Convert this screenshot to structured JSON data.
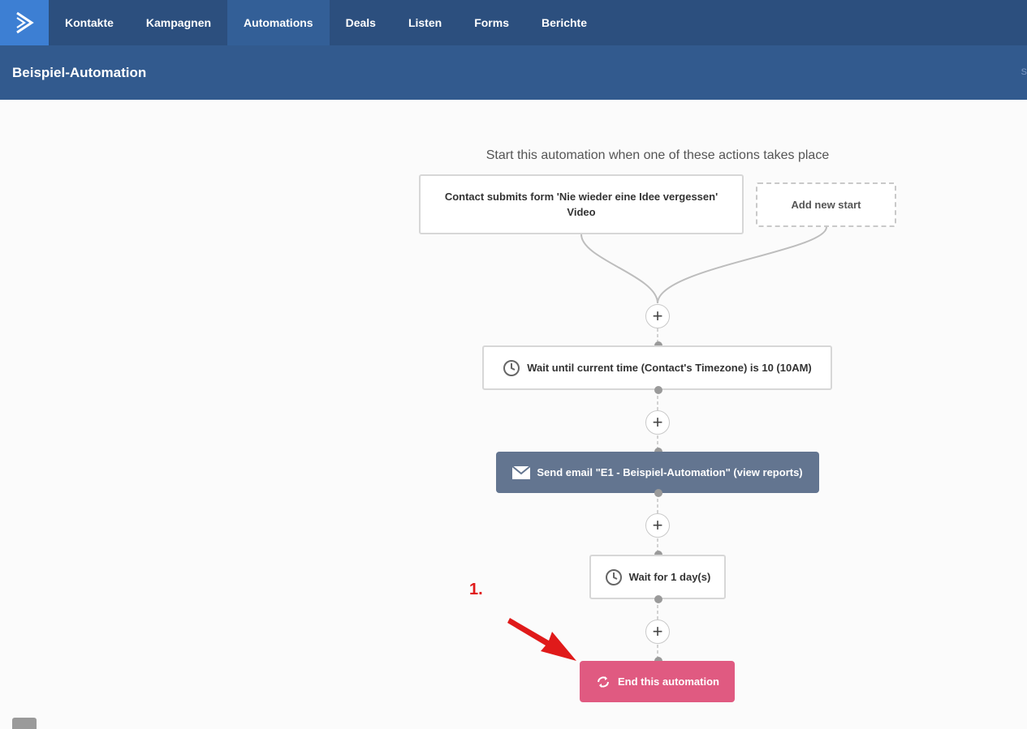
{
  "nav": {
    "items": [
      {
        "label": "Kontakte"
      },
      {
        "label": "Kampagnen"
      },
      {
        "label": "Automations"
      },
      {
        "label": "Deals"
      },
      {
        "label": "Listen"
      },
      {
        "label": "Forms"
      },
      {
        "label": "Berichte"
      }
    ],
    "active_item": "Automations"
  },
  "header": {
    "title": "Beispiel-Automation",
    "right_edge_text": "S"
  },
  "workflow": {
    "heading": "Start this automation when one of these actions takes place",
    "trigger": {
      "label": "Contact submits form 'Nie wieder eine Idee vergessen' Video"
    },
    "add_start_label": "Add new start",
    "steps": [
      {
        "icon": "clock-icon",
        "label": "Wait until current time (Contact's Timezone) is 10 (10AM)"
      },
      {
        "icon": "envelope-icon",
        "label": "Send email \"E1 - Beispiel-Automation\" (view reports)"
      },
      {
        "icon": "clock-icon",
        "label": "Wait for 1 day(s)"
      },
      {
        "icon": "loop-icon",
        "label": "End this automation"
      }
    ],
    "plus_symbol": "+"
  },
  "annotation": {
    "label": "1."
  },
  "colors": {
    "nav_bg": "#2c4f7e",
    "nav_active": "#335f97",
    "logo_bg": "#3d7fd3",
    "subheader_bg": "#325a8e",
    "email_node": "#637590",
    "end_node": "#e05a81",
    "annotation_red": "#e01a1a"
  }
}
